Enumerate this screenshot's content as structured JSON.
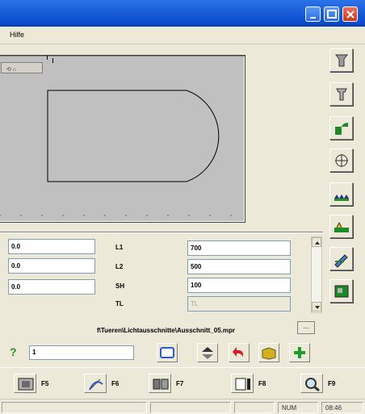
{
  "window": {
    "accent": "#0b4ccf"
  },
  "menu": {
    "items": [
      "Hilfe"
    ]
  },
  "parameters": {
    "left_values": [
      "0.0",
      "0.0",
      "0.0"
    ],
    "rows": [
      {
        "label": "L1",
        "value": "700"
      },
      {
        "label": "L2",
        "value": "500"
      },
      {
        "label": "SH",
        "value": "100"
      },
      {
        "label": "TL",
        "value": "TL"
      }
    ]
  },
  "file_path": "f\\Tueren\\Lichtausschnitte\\Ausschnitt_05.mpr",
  "browse_label": "...",
  "command": {
    "prompt_icon": "?",
    "value": "1"
  },
  "fkeys": [
    {
      "icon": "machine-icon",
      "label": "F5"
    },
    {
      "icon": "edit-curve-icon",
      "label": "F6"
    },
    {
      "icon": "tools-icon",
      "label": "F7"
    },
    {
      "icon": "window-export-icon",
      "label": "F8"
    },
    {
      "icon": "magnifier-icon",
      "label": "F9"
    }
  ],
  "status": {
    "num": "NUM",
    "time": "08:46"
  }
}
